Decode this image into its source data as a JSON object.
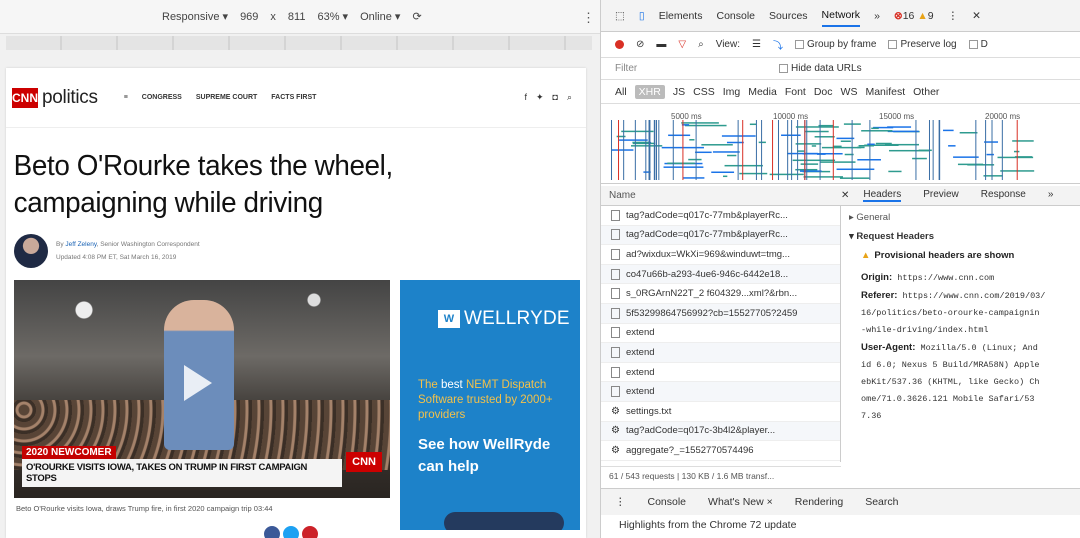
{
  "responsive_bar": {
    "device": "Responsive ▾",
    "width": "969",
    "x": "x",
    "height": "811",
    "zoom": "63% ▾",
    "network": "Online ▾"
  },
  "page": {
    "logo": "CNN",
    "section": "politics",
    "nav": [
      "CONGRESS",
      "SUPREME COURT",
      "FACTS FIRST"
    ],
    "headline": "Beto O'Rourke takes the wheel, campaigning while driving",
    "byline_author_prefix": "By",
    "byline_author": "Jeff Zeleny",
    "byline_role": ", Senior Washington Correspondent",
    "byline_updated": "Updated 4:08 PM ET, Sat March 16, 2019",
    "video_tag": "2020 NEWCOMER",
    "video_lower_third": "O'ROURKE VISITS IOWA, TAKES ON TRUMP IN FIRST CAMPAIGN STOPS",
    "video_logo": "CNN",
    "video_caption": "Beto O'Rourke visits Iowa, draws Trump fire, in first 2020 campaign trip 03:44",
    "ad": {
      "logo_mark": "W",
      "logo_text": "WELLRYDE",
      "small_1": "The ",
      "small_hl": "best",
      "small_2": " NEMT Dispatch Software trusted by 2000+ providers",
      "big": "See how WellRyde can help"
    },
    "colors": {
      "cnn_red": "#cc0000",
      "ad_blue": "#1d82c9"
    }
  },
  "devtools": {
    "tabs": [
      "Elements",
      "Console",
      "Sources",
      "Network",
      "»"
    ],
    "active_tab": "Network",
    "errors": "16",
    "warnings": "9",
    "toolbar": {
      "view": "View:",
      "group_by_frame": "Group by frame",
      "preserve_log": "Preserve log",
      "disable_cache": "D"
    },
    "filter_placeholder": "Filter",
    "hide_data_urls": "Hide data URLs",
    "types": [
      "All",
      "XHR",
      "JS",
      "CSS",
      "Img",
      "Media",
      "Font",
      "Doc",
      "WS",
      "Manifest",
      "Other"
    ],
    "selected_type": "XHR",
    "timeline_ticks": [
      "5000 ms",
      "10000 ms",
      "15000 ms",
      "20000 ms"
    ],
    "name_header": "Name",
    "detail_tabs": [
      "Headers",
      "Preview",
      "Response",
      "»"
    ],
    "active_detail_tab": "Headers",
    "requests": [
      "tag?adCode=q017c-77mb&playerRc...",
      "tag?adCode=q017c-77mb&playerRc...",
      "ad?wixdux=WkXi=969&winduwt=tmg...",
      "co47u66b-a293-4ue6-946c-6442e18...",
      "s_0RGArnN22T_2 f604329...xml?&rbn...",
      "5f53299864756992?cb=15527705?2459",
      "extend",
      "extend",
      "extend",
      "extend",
      "settings.txt",
      "tag?adCode=q017c-3b4l2&player...",
      "aggregate?_=1552770574496"
    ],
    "status": "61 / 543 requests | 130 KB / 1.6 MB transf...",
    "general": "▸ General",
    "request_headers": "▾ Request Headers",
    "provisional": "Provisional headers are shown",
    "origin_k": "Origin:",
    "origin_v": "https://www.cnn.com",
    "referer_k": "Referer:",
    "referer_v1": "https://www.cnn.com/2019/03/",
    "referer_v2": "16/politics/beto-orourke-campaignin",
    "referer_v3": "-while-driving/index.html",
    "ua_k": "User-Agent:",
    "ua_v1": "Mozilla/5.0 (Linux; And",
    "ua_v2": "id 6.0; Nexus 5 Build/MRA58N) Apple",
    "ua_v3": "ebKit/537.36 (KHTML, like Gecko) Ch",
    "ua_v4": "ome/71.0.3626.121 Mobile Safari/53",
    "ua_v5": "7.36",
    "drawer_tabs": [
      "Console",
      "What's New ×",
      "Rendering",
      "Search"
    ],
    "drawer_msg": "Highlights from the Chrome 72 update"
  }
}
